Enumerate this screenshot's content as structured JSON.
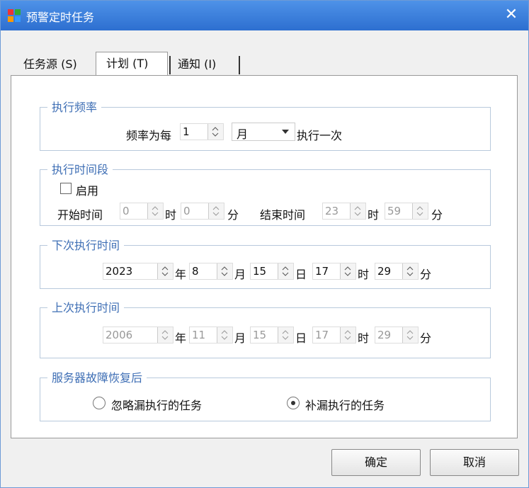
{
  "window": {
    "title": "预警定时任务",
    "close_label": "✕"
  },
  "tabs": [
    {
      "label": "任务源 (S)"
    },
    {
      "label": "计划 (T)"
    },
    {
      "label": "通知 (I)"
    }
  ],
  "frequency": {
    "legend": "执行频率",
    "prefix": "频率为每",
    "value": "1",
    "unit": "月",
    "suffix": "执行一次"
  },
  "period": {
    "legend": "执行时间段",
    "enable_label": "启用",
    "enabled": false,
    "start_label": "开始时间",
    "start_hour": "0",
    "start_minute": "0",
    "end_label": "结束时间",
    "end_hour": "23",
    "end_minute": "59",
    "hour_unit": "时",
    "minute_unit": "分"
  },
  "next_run": {
    "legend": "下次执行时间",
    "year": "2023",
    "month": "8",
    "day": "15",
    "hour": "17",
    "minute": "29"
  },
  "last_run": {
    "legend": "上次执行时间",
    "year": "2006",
    "month": "11",
    "day": "15",
    "hour": "17",
    "minute": "29"
  },
  "units": {
    "year": "年",
    "month": "月",
    "day": "日",
    "hour": "时",
    "minute": "分"
  },
  "recovery": {
    "legend": "服务器故障恢复后",
    "option_ignore": "忽略漏执行的任务",
    "option_compensate": "补漏执行的任务",
    "selected": "compensate"
  },
  "buttons": {
    "ok": "确定",
    "cancel": "取消"
  },
  "colors": {
    "titlebar": "#2d6fd0",
    "legend": "#3f6fb5"
  }
}
